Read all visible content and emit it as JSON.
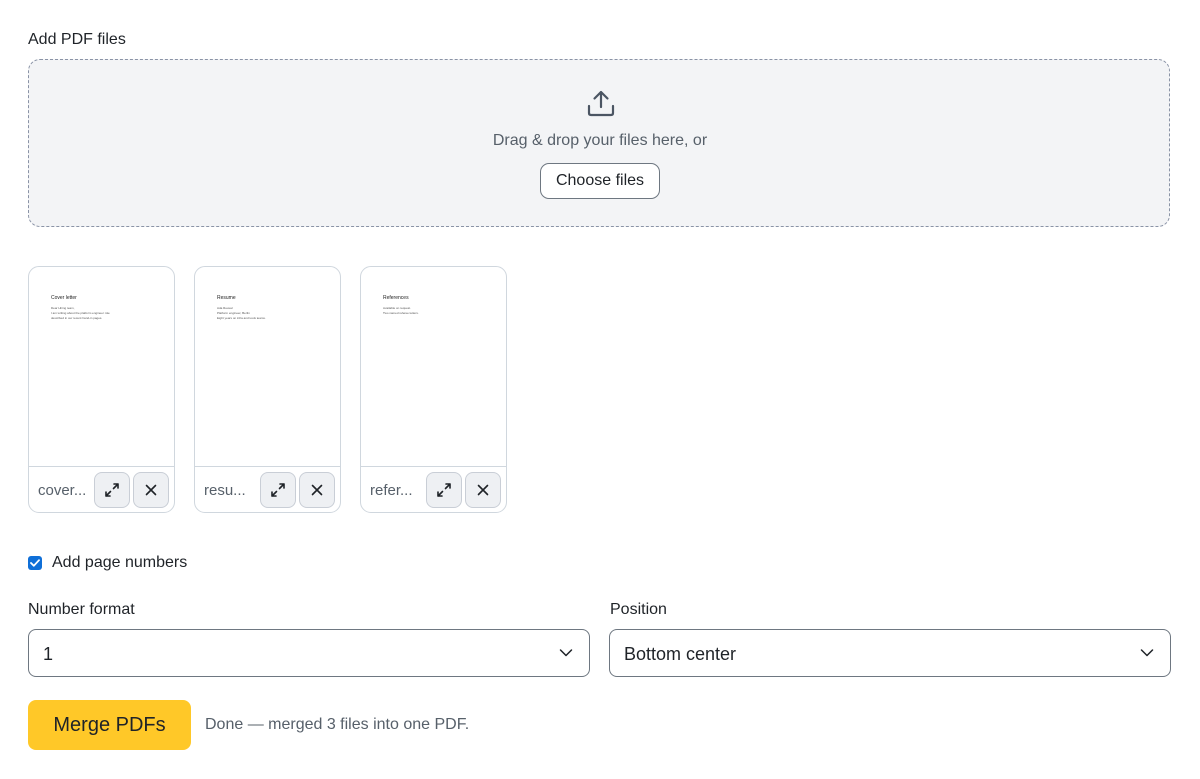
{
  "add_files": {
    "title": "Add PDF files",
    "upload_icon": "upload-tray-icon",
    "drop_text": "Drag & drop your files here, or",
    "choose_label": "Choose files"
  },
  "files": [
    {
      "name": "cover...",
      "preview_title": "Cover letter",
      "preview_lines": [
        "Dear Hiring team,",
        "I am writing about the platform engineer role",
        "described in our recent hand-in pages."
      ]
    },
    {
      "name": "resu...",
      "preview_title": "Resume",
      "preview_lines": [
        "Ada Reveal",
        "Platform engineer, Berlin",
        "Eight years on infra and tools teams."
      ]
    },
    {
      "name": "refer...",
      "preview_title": "References",
      "preview_lines": [
        "Available on request.",
        "Two named referee letters."
      ]
    }
  ],
  "file_actions": {
    "expand_icon": "expand-arrows-icon",
    "remove_icon": "close-icon"
  },
  "page_numbers": {
    "checked": true,
    "label": "Add page numbers"
  },
  "number_format": {
    "label": "Number format",
    "value": "1"
  },
  "position": {
    "label": "Position",
    "value": "Bottom center"
  },
  "merge": {
    "label": "Merge PDFs",
    "status": "Done — merged 3 files into one PDF."
  },
  "colors": {
    "accent": "#ffc828",
    "checkbox": "#0f6fd8",
    "dropzone_bg": "#f3f4f6"
  }
}
